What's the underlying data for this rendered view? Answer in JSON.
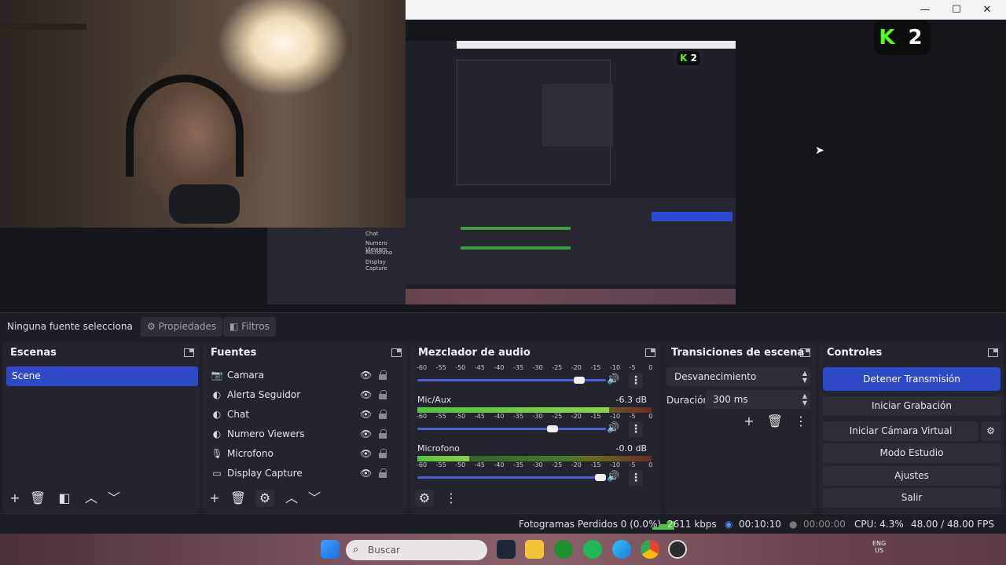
{
  "window": {
    "controls": {
      "minimize": "—",
      "maximize": "☐",
      "close": "✕"
    },
    "brand_badge": "K2"
  },
  "preview": {
    "nested_sources": [
      "Chat",
      "Numero Viewers",
      "Microfono",
      "Display Capture"
    ]
  },
  "source_toolbar": {
    "no_selection": "Ninguna fuente selecciona",
    "properties": "Propiedades",
    "filters": "Filtros"
  },
  "scenes": {
    "title": "Escenas",
    "items": [
      "Scene"
    ]
  },
  "sources": {
    "title": "Fuentes",
    "items": [
      {
        "label": "Camara",
        "icon": "camera-icon",
        "glyph": "📷"
      },
      {
        "label": "Alerta Seguidor",
        "icon": "browser-icon",
        "glyph": "◐"
      },
      {
        "label": "Chat",
        "icon": "browser-icon",
        "glyph": "◐"
      },
      {
        "label": "Numero Viewers",
        "icon": "browser-icon",
        "glyph": "◐"
      },
      {
        "label": "Microfono",
        "icon": "microphone-icon",
        "glyph": "🎙"
      },
      {
        "label": "Display Capture",
        "icon": "monitor-icon",
        "glyph": "▭"
      }
    ]
  },
  "mixer": {
    "title": "Mezclador de audio",
    "scale": [
      "-60",
      "-55",
      "-50",
      "-45",
      "-40",
      "-35",
      "-30",
      "-25",
      "-20",
      "-15",
      "-10",
      "-5",
      "0"
    ],
    "channels": [
      {
        "name": "",
        "db": "",
        "level": 0.0,
        "volume": 0.88
      },
      {
        "name": "Mic/Aux",
        "db": "-6.3 dB",
        "level": 0.82,
        "volume": 0.73
      },
      {
        "name": "Microfono",
        "db": "-0.0 dB",
        "level": 0.22,
        "volume": 1.0
      }
    ]
  },
  "transitions": {
    "title": "Transiciones de escena",
    "selected": "Desvanecimiento",
    "duration_label": "Duración",
    "duration_value": "300 ms"
  },
  "controls": {
    "title": "Controles",
    "stop_stream": "Detener Transmisión",
    "start_recording": "Iniciar Grabación",
    "start_virtual_cam": "Iniciar Cámara Virtual",
    "studio_mode": "Modo Estudio",
    "settings": "Ajustes",
    "exit": "Salir"
  },
  "status": {
    "dropped": "Fotogramas Perdidos 0 (0.0%)",
    "bitrate": "2611 kbps",
    "stream_time": "00:10:10",
    "rec_time": "00:00:00",
    "cpu": "CPU: 4.3%",
    "fps": "48.00 / 48.00 FPS"
  },
  "taskbar": {
    "search_placeholder": "Buscar",
    "lang_line1": "ENG",
    "lang_line2": "US"
  },
  "colors": {
    "accent": "#2f48c6",
    "dock_bg": "#23242e",
    "kick_green": "#53fc18"
  }
}
